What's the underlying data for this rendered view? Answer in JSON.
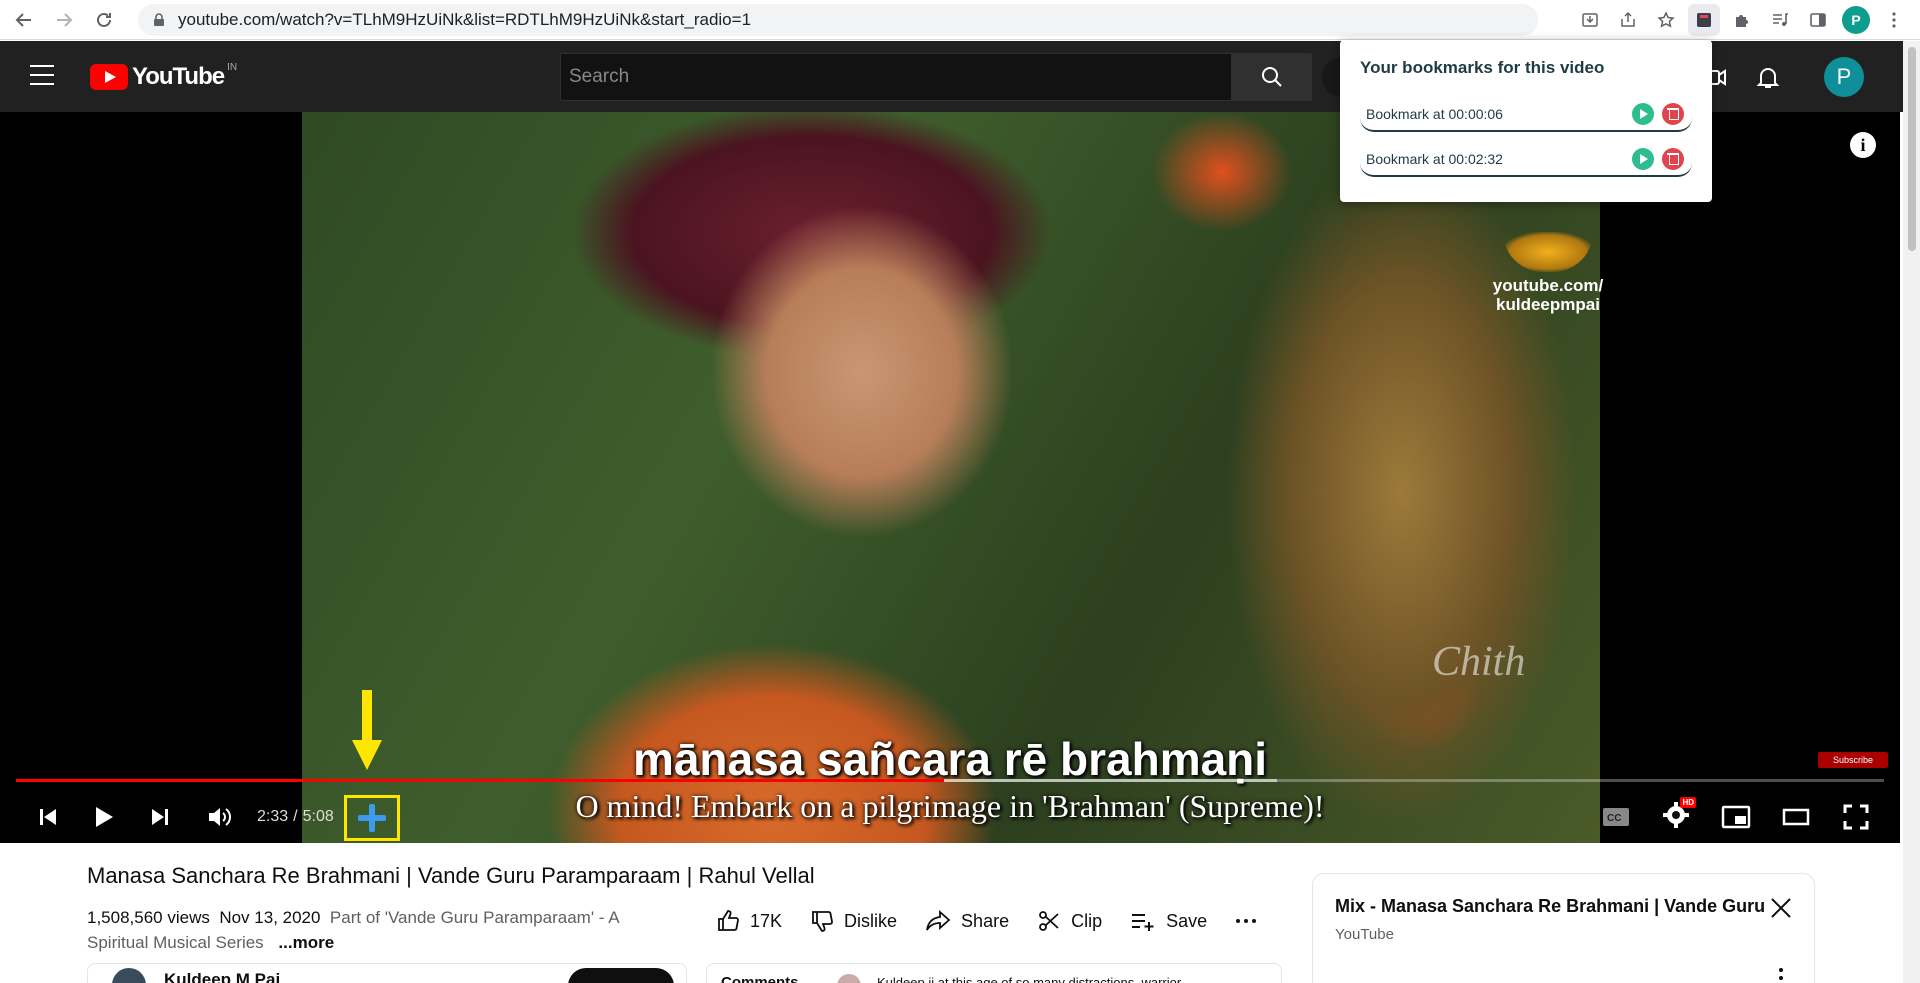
{
  "browser": {
    "url": "youtube.com/watch?v=TLhM9HzUiNk&list=RDTLhM9HzUiNk&start_radio=1",
    "profile_initial": "P"
  },
  "header": {
    "logo_text": "YouTube",
    "country": "IN",
    "search_placeholder": "Search",
    "avatar_initial": "P"
  },
  "player": {
    "subtitle_line1": "mānasa sañcara rē brahmaṇi",
    "subtitle_line2": "O mind! Embark on a pilgrimage in 'Brahman' (Supreme)!",
    "watermark_line1": "youtube.com/",
    "watermark_line2": "kuldeepmpai",
    "signature": "Chith",
    "subscribe_mini": "Subscribe",
    "current_time": "2:33",
    "time_separator": "/",
    "duration": "5:08",
    "played_fraction": 0.497,
    "buffered_fraction": 0.675,
    "hd_badge": "HD",
    "progress_color": "#ff0000",
    "highlight_color": "#ffe600"
  },
  "video": {
    "title": "Manasa Sanchara Re Brahmani | Vande Guru Paramparaam | Rahul Vellal",
    "views": "1,508,560 views",
    "date": "Nov 13, 2020",
    "description_line1": "Part of 'Vande Guru Paramparaam' - A",
    "description_line2": "Spiritual Musical Series",
    "more_label": "...more",
    "likes": "17K",
    "dislike_label": "Dislike",
    "share_label": "Share",
    "clip_label": "Clip",
    "save_label": "Save",
    "owner_name": "Kuldeep M Pai",
    "comments_label": "Comments",
    "comment_preview": "Kuldeep ji at this age of so many distractions, warrior"
  },
  "mix": {
    "title": "Mix - Manasa Sanchara Re Brahmani | Vande Guru",
    "source": "YouTube"
  },
  "popup": {
    "title": "Your bookmarks for this video",
    "bookmarks": [
      {
        "label": "Bookmark at 00:00:06"
      },
      {
        "label": "Bookmark at 00:02:32"
      }
    ]
  }
}
